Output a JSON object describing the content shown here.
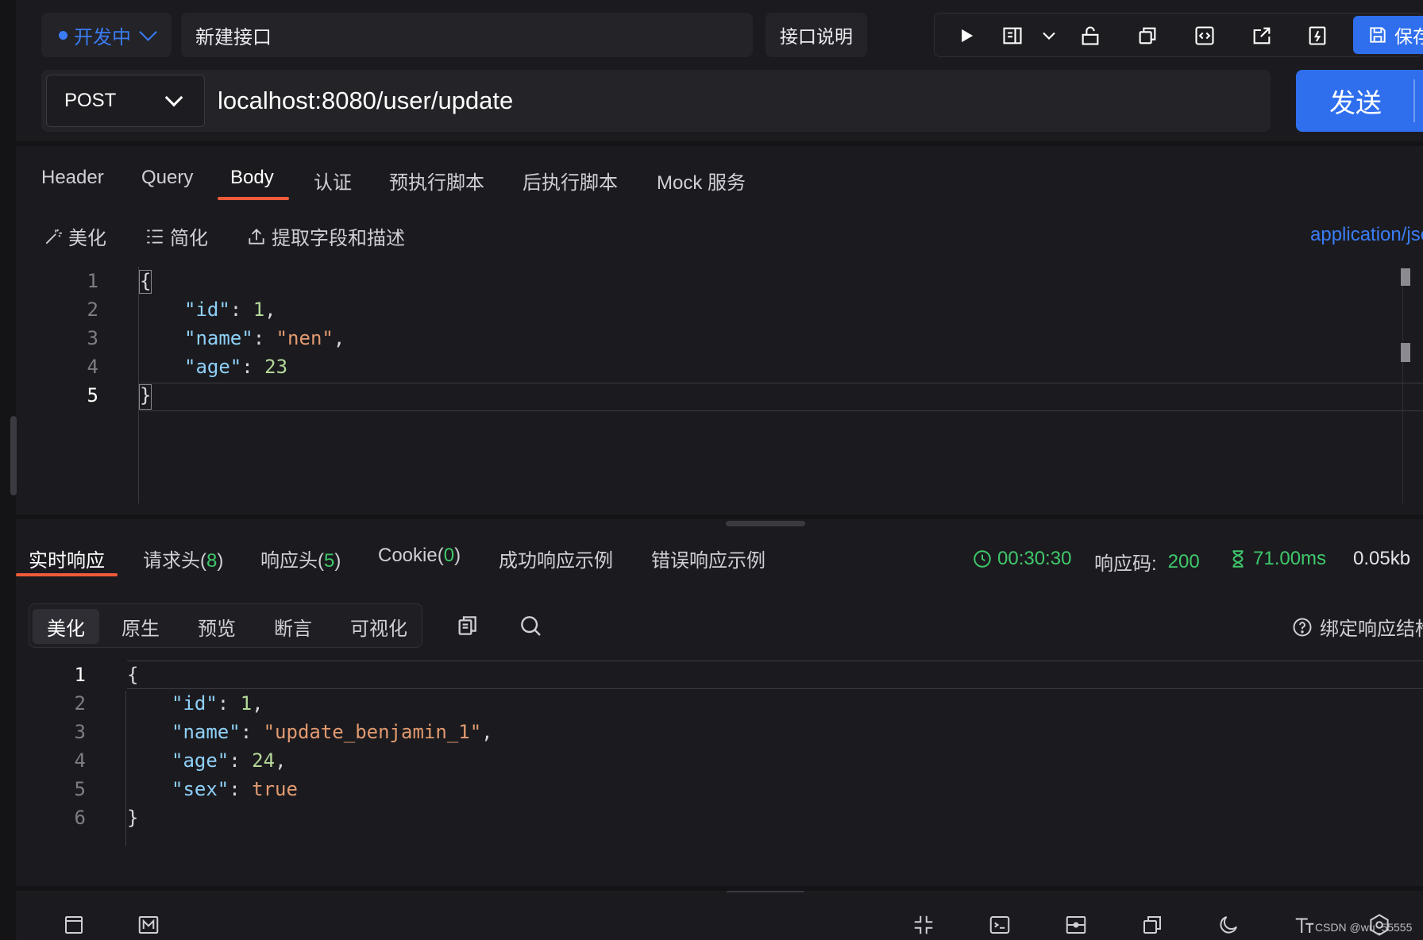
{
  "toolbar": {
    "environment": "开发中",
    "api_name": "新建接口",
    "doc_button": "接口说明",
    "save_label": "保存"
  },
  "request": {
    "method": "POST",
    "url": "localhost:8080/user/update",
    "send_label": "发送",
    "tabs": [
      "Header",
      "Query",
      "Body",
      "认证",
      "预执行脚本",
      "后执行脚本",
      "Mock 服务"
    ],
    "active_tab": "Body",
    "body_tools": {
      "beautify": "美化",
      "simplify": "简化",
      "extract": "提取字段和描述"
    },
    "content_type": "application/json",
    "line_numbers": [
      "1",
      "2",
      "3",
      "4",
      "5"
    ],
    "body_lines": {
      "l1": "{",
      "l2_key": "\"id\"",
      "l2_val": "1",
      "l3_key": "\"name\"",
      "l3_val": "\"nen\"",
      "l4_key": "\"age\"",
      "l4_val": "23",
      "l5": "}"
    }
  },
  "response": {
    "tabs": {
      "realtime": "实时响应",
      "req_headers": "请求头",
      "req_headers_count": "8",
      "resp_headers": "响应头",
      "resp_headers_count": "5",
      "cookie": "Cookie",
      "cookie_count": "0",
      "success_example": "成功响应示例",
      "error_example": "错误响应示例"
    },
    "time": "00:30:30",
    "status_label": "响应码:",
    "status_code": "200",
    "duration": "71.00ms",
    "size": "0.05kb",
    "view_tabs": [
      "美化",
      "原生",
      "预览",
      "断言",
      "可视化"
    ],
    "active_view": "美化",
    "bind_label": "绑定响应结构",
    "line_numbers": [
      "1",
      "2",
      "3",
      "4",
      "5",
      "6"
    ],
    "body_lines": {
      "l1": "{",
      "l2_key": "\"id\"",
      "l2_val": "1",
      "l3_key": "\"name\"",
      "l3_val": "\"update_benjamin_1\"",
      "l4_key": "\"age\"",
      "l4_val": "24",
      "l5_key": "\"sex\"",
      "l5_val": "true",
      "l6": "}"
    }
  },
  "footer": {
    "watermark": "CSDN @wu_55555"
  },
  "colors": {
    "accent": "#2f6fee",
    "tab_underline": "#ef5b3a",
    "success": "#3fc86b"
  }
}
